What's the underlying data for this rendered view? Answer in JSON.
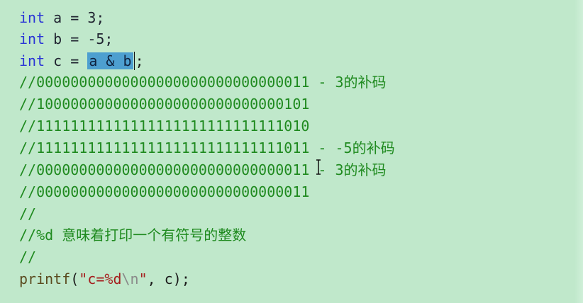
{
  "code": {
    "line1": {
      "kw": "int",
      "rest": " a = 3;"
    },
    "line2": {
      "kw": "int",
      "rest": " b = -5;"
    },
    "line3": {
      "kw": "int",
      "pre": " c = ",
      "selected": "a & b",
      "post": ";"
    },
    "line4": "//00000000000000000000000000000011 - 3的补码",
    "line5": "//10000000000000000000000000000101",
    "line6": "//11111111111111111111111111111010",
    "line7": "//11111111111111111111111111111011 - -5的补码",
    "line8": "//00000000000000000000000000000011 - 3的补码",
    "line9": "//00000000000000000000000000000011",
    "line10": "//",
    "line11": "//%d 意味着打印一个有符号的整数",
    "line12": "//",
    "line13": {
      "fn": "printf",
      "open": "(",
      "str_a": "\"c=%d",
      "esc": "\\n",
      "str_b": "\"",
      "rest": ", c);"
    }
  },
  "colors": {
    "background": "#c0e8cb",
    "keyword": "#2a35d6",
    "comment": "#1f8a1f",
    "string": "#a51d1d",
    "selection": "#4d9fd0"
  }
}
